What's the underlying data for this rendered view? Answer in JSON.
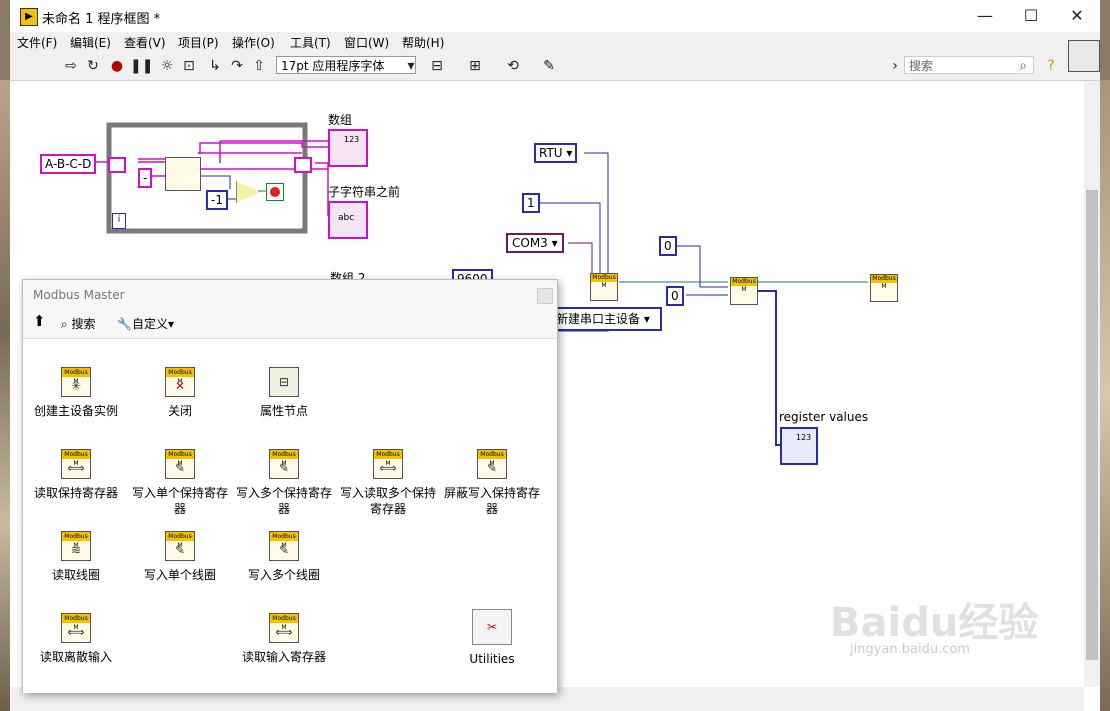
{
  "window": {
    "title": "未命名 1 程序框图 *",
    "minimize": "—",
    "maximize": "☐",
    "close": "✕"
  },
  "menu": [
    "文件(F)",
    "编辑(E)",
    "查看(V)",
    "项目(P)",
    "操作(O)",
    "工具(T)",
    "窗口(W)",
    "帮助(H)"
  ],
  "toolbar": {
    "font": "17pt 应用程序字体",
    "search_placeholder": "搜索"
  },
  "diagram": {
    "string_const": "A-B-C-D",
    "sep_const": "-",
    "neg_one": "-1",
    "array_label": "数组",
    "substring_label": "子字符串之前",
    "array2_label": "数组 2",
    "hidden_const": "9600",
    "rtu": "RTU",
    "one": "1",
    "com": "COM3",
    "zero_a": "0",
    "zero_b": "0",
    "new_serial": "新建串口主设备",
    "register_values": "register values",
    "loop_i": "i",
    "index_123": "123",
    "abc": "abc"
  },
  "palette": {
    "title": "Modbus Master",
    "tool_search": "搜索",
    "tool_customize": "自定义▾",
    "items": [
      "创建主设备实例",
      "关闭",
      "属性节点",
      "读取保持寄存器",
      "写入单个保持寄存器",
      "写入多个保持寄存器",
      "写入读取多个保持寄存器",
      "屏蔽写入保持寄存器",
      "读取线圈",
      "写入单个线圈",
      "写入多个线圈",
      "读取离散输入",
      "读取输入寄存器",
      "Utilities"
    ]
  },
  "watermark": {
    "main": "Baidu经验",
    "sub": "jingyan.baidu.com"
  },
  "colors": {
    "string_wire": "#d010d0",
    "numeric_wire": "#2a2ab0",
    "io_wire": "#0a7a9a",
    "arrow": "#e02020"
  }
}
